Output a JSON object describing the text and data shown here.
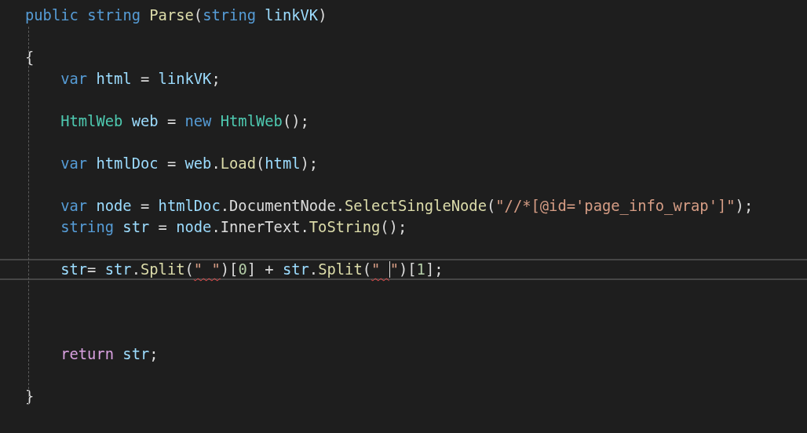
{
  "editor": {
    "lines": [
      {
        "kind": "code",
        "current": false,
        "tokens": [
          {
            "text": "public ",
            "kind": "keyword"
          },
          {
            "text": "string ",
            "kind": "keyword"
          },
          {
            "text": "Parse",
            "kind": "method"
          },
          {
            "text": "(",
            "kind": "plain"
          },
          {
            "text": "string ",
            "kind": "keyword"
          },
          {
            "text": "linkVK",
            "kind": "variable"
          },
          {
            "text": ")",
            "kind": "plain"
          }
        ]
      },
      {
        "kind": "blank"
      },
      {
        "kind": "code",
        "current": false,
        "tokens": [
          {
            "text": "{",
            "kind": "plain"
          }
        ],
        "children": [
          {
            "kind": "code",
            "current": false,
            "tokens": [
              {
                "text": "var ",
                "kind": "keyword"
              },
              {
                "text": "html",
                "kind": "variable"
              },
              {
                "text": " = ",
                "kind": "plain"
              },
              {
                "text": "linkVK",
                "kind": "variable"
              },
              {
                "text": ";",
                "kind": "plain"
              }
            ]
          },
          {
            "kind": "blank"
          },
          {
            "kind": "code",
            "current": false,
            "tokens": [
              {
                "text": "HtmlWeb ",
                "kind": "type"
              },
              {
                "text": "web",
                "kind": "variable"
              },
              {
                "text": " = ",
                "kind": "plain"
              },
              {
                "text": "new ",
                "kind": "keyword"
              },
              {
                "text": "HtmlWeb",
                "kind": "type"
              },
              {
                "text": "();",
                "kind": "plain"
              }
            ]
          },
          {
            "kind": "blank"
          },
          {
            "kind": "code",
            "current": false,
            "tokens": [
              {
                "text": "var ",
                "kind": "keyword"
              },
              {
                "text": "htmlDoc",
                "kind": "variable"
              },
              {
                "text": " = ",
                "kind": "plain"
              },
              {
                "text": "web",
                "kind": "variable"
              },
              {
                "text": ".",
                "kind": "plain"
              },
              {
                "text": "Load",
                "kind": "method"
              },
              {
                "text": "(",
                "kind": "plain"
              },
              {
                "text": "html",
                "kind": "variable"
              },
              {
                "text": ");",
                "kind": "plain"
              }
            ]
          },
          {
            "kind": "blank"
          },
          {
            "kind": "code",
            "current": false,
            "tokens": [
              {
                "text": "var ",
                "kind": "keyword"
              },
              {
                "text": "node",
                "kind": "variable"
              },
              {
                "text": " = ",
                "kind": "plain"
              },
              {
                "text": "htmlDoc",
                "kind": "variable"
              },
              {
                "text": ".DocumentNode.",
                "kind": "plain"
              },
              {
                "text": "SelectSingleNode",
                "kind": "method"
              },
              {
                "text": "(",
                "kind": "plain"
              },
              {
                "text": "\"//*[@id='page_info_wrap']\"",
                "kind": "string"
              },
              {
                "text": ");",
                "kind": "plain"
              }
            ]
          },
          {
            "kind": "code",
            "current": false,
            "tokens": [
              {
                "text": "string ",
                "kind": "keyword"
              },
              {
                "text": "str",
                "kind": "variable"
              },
              {
                "text": " = ",
                "kind": "plain"
              },
              {
                "text": "node",
                "kind": "variable"
              },
              {
                "text": ".InnerText.",
                "kind": "plain"
              },
              {
                "text": "ToString",
                "kind": "method"
              },
              {
                "text": "();",
                "kind": "plain"
              }
            ]
          },
          {
            "kind": "blank"
          },
          {
            "kind": "code",
            "current": true,
            "tokens": [
              {
                "text": "str",
                "kind": "variable"
              },
              {
                "text": "= ",
                "kind": "plain"
              },
              {
                "text": "str",
                "kind": "variable"
              },
              {
                "text": ".",
                "kind": "plain"
              },
              {
                "text": "Split",
                "kind": "method"
              },
              {
                "text": "(",
                "kind": "plain"
              },
              {
                "text": "\" \"",
                "kind": "string",
                "squiggle": true
              },
              {
                "text": ")[",
                "kind": "plain"
              },
              {
                "text": "0",
                "kind": "number"
              },
              {
                "text": "] + ",
                "kind": "plain"
              },
              {
                "text": "str",
                "kind": "variable"
              },
              {
                "text": ".",
                "kind": "plain"
              },
              {
                "text": "Split",
                "kind": "method"
              },
              {
                "text": "(",
                "kind": "plain"
              },
              {
                "text": "\" ",
                "kind": "string",
                "squiggle": true
              },
              {
                "text": "\"",
                "kind": "string",
                "caret_before": true
              },
              {
                "text": ")[",
                "kind": "plain"
              },
              {
                "text": "1",
                "kind": "number"
              },
              {
                "text": "];",
                "kind": "plain"
              }
            ]
          },
          {
            "kind": "blank"
          },
          {
            "kind": "blank"
          },
          {
            "kind": "blank"
          },
          {
            "kind": "code",
            "current": false,
            "tokens": [
              {
                "text": "return ",
                "kind": "control"
              },
              {
                "text": "str",
                "kind": "variable"
              },
              {
                "text": ";",
                "kind": "plain"
              }
            ]
          },
          {
            "kind": "blank"
          }
        ]
      },
      {
        "kind": "code",
        "current": false,
        "tokens": [
          {
            "text": "}",
            "kind": "plain"
          }
        ]
      }
    ]
  }
}
